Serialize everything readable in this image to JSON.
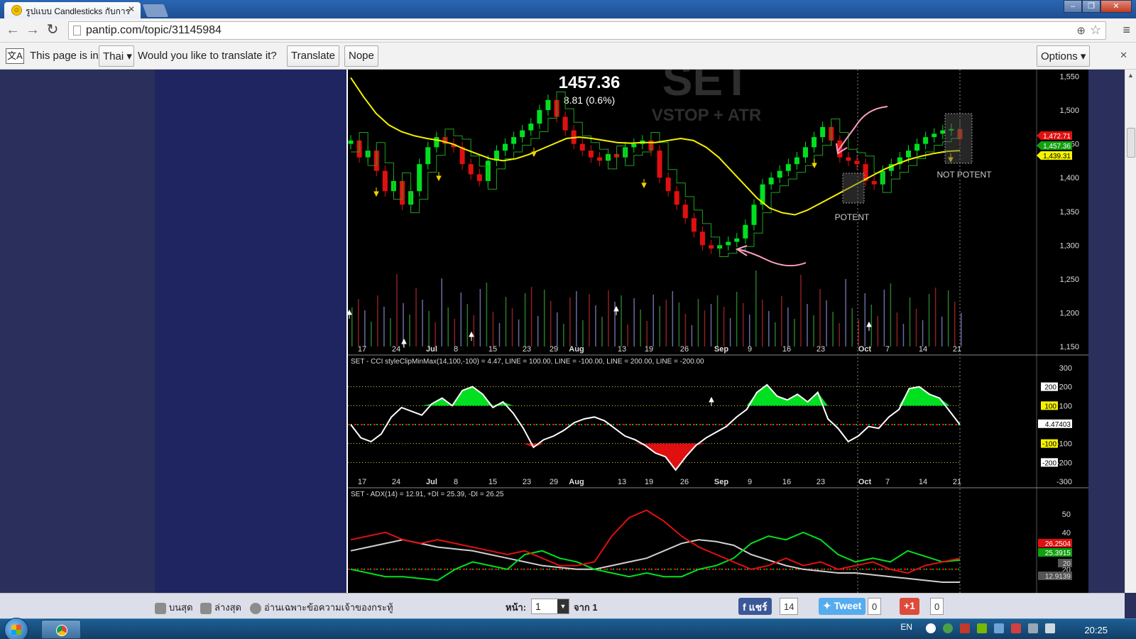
{
  "tab": {
    "title": "รูปแบบ Candlesticks กับการ"
  },
  "address": {
    "url": "pantip.com/topic/31145984"
  },
  "translate_bar": {
    "prefix": "This page is in",
    "language": "Thai",
    "question": "Would you like to translate it?",
    "translate_label": "Translate",
    "nope_label": "Nope",
    "options_label": "Options"
  },
  "chart_header": {
    "price": "1457.36",
    "change": "8.81 (0.6%)",
    "watermark": "SET",
    "watermark_sub": "VSTOP + ATR"
  },
  "annotations": {
    "potent": "POTENT",
    "not_potent": "NOT POTENT"
  },
  "indicators": {
    "cci_title": "SET - CCI styleClipMinMax(14,100,-100) = 4.47, LINE = 100.00, LINE = -100.00, LINE = 200.00, LINE = -200.00",
    "adx_title": "SET - ADX(14) = 12.91, +DI = 25.39, -DI = 26.25"
  },
  "chart_data": [
    {
      "type": "candlestick",
      "title": "SET",
      "x_labels": [
        "17",
        "24",
        "Jul",
        "8",
        "15",
        "23",
        "29",
        "Aug",
        "13",
        "19",
        "26",
        "Sep",
        "9",
        "16",
        "23",
        "Oct",
        "7",
        "14",
        "21"
      ],
      "y_ticks": [
        "1,550",
        "1,500",
        "1,450",
        "1,400",
        "1,350",
        "1,300",
        "1,250",
        "1,200",
        "1,150"
      ],
      "ylim": [
        1150,
        1560
      ],
      "price_badges": [
        {
          "value": "1,472.71",
          "color": "#e01010"
        },
        {
          "value": "1,457.36",
          "color": "#10a010"
        },
        {
          "value": "1,439.31",
          "color": "#f5f500"
        }
      ],
      "close": [
        1455,
        1430,
        1440,
        1410,
        1380,
        1395,
        1360,
        1380,
        1420,
        1445,
        1460,
        1450,
        1445,
        1420,
        1405,
        1395,
        1425,
        1440,
        1450,
        1460,
        1470,
        1480,
        1500,
        1515,
        1490,
        1470,
        1450,
        1440,
        1430,
        1425,
        1435,
        1430,
        1445,
        1450,
        1455,
        1440,
        1400,
        1380,
        1360,
        1340,
        1320,
        1300,
        1295,
        1300,
        1305,
        1310,
        1330,
        1360,
        1390,
        1400,
        1410,
        1420,
        1430,
        1445,
        1460,
        1475,
        1455,
        1430,
        1425,
        1420,
        1395,
        1390,
        1410,
        1420,
        1430,
        1440,
        1450,
        1460,
        1465,
        1470,
        1472,
        1457
      ],
      "ma": [
        1548,
        1520,
        1495,
        1478,
        1468,
        1462,
        1458,
        1455,
        1450,
        1442,
        1435,
        1428,
        1425,
        1428,
        1434,
        1442,
        1450,
        1458,
        1460,
        1458,
        1455,
        1452,
        1451,
        1452,
        1452,
        1455,
        1458,
        1455,
        1445,
        1430,
        1410,
        1390,
        1370,
        1355,
        1348,
        1345,
        1352,
        1362,
        1372,
        1382,
        1392,
        1402,
        1412,
        1420,
        1427,
        1432,
        1436,
        1439,
        1440
      ]
    },
    {
      "type": "line",
      "title": "CCI",
      "y_ticks": [
        "300",
        "200",
        "100",
        "-100",
        "-200",
        "-300"
      ],
      "ylim": [
        -300,
        300
      ],
      "badges": [
        "200",
        "100",
        "4.47403",
        "-100",
        "-200"
      ],
      "values": [
        0,
        -70,
        -90,
        -50,
        40,
        90,
        70,
        50,
        110,
        140,
        100,
        180,
        200,
        160,
        90,
        120,
        60,
        -20,
        -120,
        -80,
        -60,
        -30,
        10,
        30,
        40,
        20,
        -20,
        -60,
        -80,
        -110,
        -150,
        -170,
        -240,
        -170,
        -110,
        -70,
        -40,
        -10,
        40,
        80,
        170,
        210,
        150,
        130,
        160,
        120,
        170,
        30,
        -20,
        -90,
        -60,
        -10,
        -20,
        40,
        80,
        190,
        200,
        160,
        140,
        70,
        0
      ]
    },
    {
      "type": "line",
      "title": "ADX",
      "y_ticks": [
        "50",
        "40",
        "30",
        "20"
      ],
      "ylim": [
        8,
        58
      ],
      "badges": [
        "26.2504",
        "25.3915",
        "20",
        "12.9139"
      ],
      "series": [
        {
          "name": "ADX",
          "values": [
            30,
            32,
            34,
            36,
            34,
            32,
            31,
            30,
            28,
            26,
            24,
            22,
            21,
            20,
            20,
            22,
            24,
            26,
            30,
            34,
            36,
            35,
            33,
            28,
            25,
            22,
            20,
            19,
            18,
            18,
            17,
            16,
            15,
            14,
            13,
            13
          ]
        },
        {
          "name": "+DI",
          "values": [
            20,
            18,
            16,
            16,
            15,
            14,
            20,
            24,
            22,
            20,
            28,
            30,
            26,
            24,
            20,
            18,
            16,
            18,
            16,
            16,
            20,
            22,
            26,
            34,
            38,
            36,
            40,
            36,
            28,
            24,
            26,
            24,
            30,
            27,
            24,
            25
          ]
        },
        {
          "name": "-DI",
          "values": [
            36,
            38,
            40,
            36,
            34,
            36,
            34,
            32,
            30,
            28,
            30,
            26,
            22,
            22,
            24,
            38,
            48,
            52,
            46,
            38,
            32,
            28,
            24,
            20,
            22,
            26,
            22,
            24,
            20,
            22,
            24,
            20,
            18,
            22,
            24,
            26
          ]
        }
      ]
    }
  ],
  "bottom_bar": {
    "top_label": "บนสุด",
    "bottom_label": "ล่างสุด",
    "owner_label": "อ่านเฉพาะข้อความเจ้าของกระทู้",
    "page_label": "หน้า:",
    "page_value": "1",
    "of_label": "จาก 1",
    "share_label": "แชร์",
    "share_count": "14",
    "tweet_label": "Tweet",
    "tweet_count": "0",
    "gplus_label": "+1",
    "gplus_count": "0"
  },
  "taskbar": {
    "lang": "EN",
    "time": "20:25"
  },
  "colors": {
    "up": "#00e020",
    "down": "#e01010",
    "ma": "#f5f000",
    "cci": "#ffffff",
    "adx": "#d0d0d0"
  }
}
